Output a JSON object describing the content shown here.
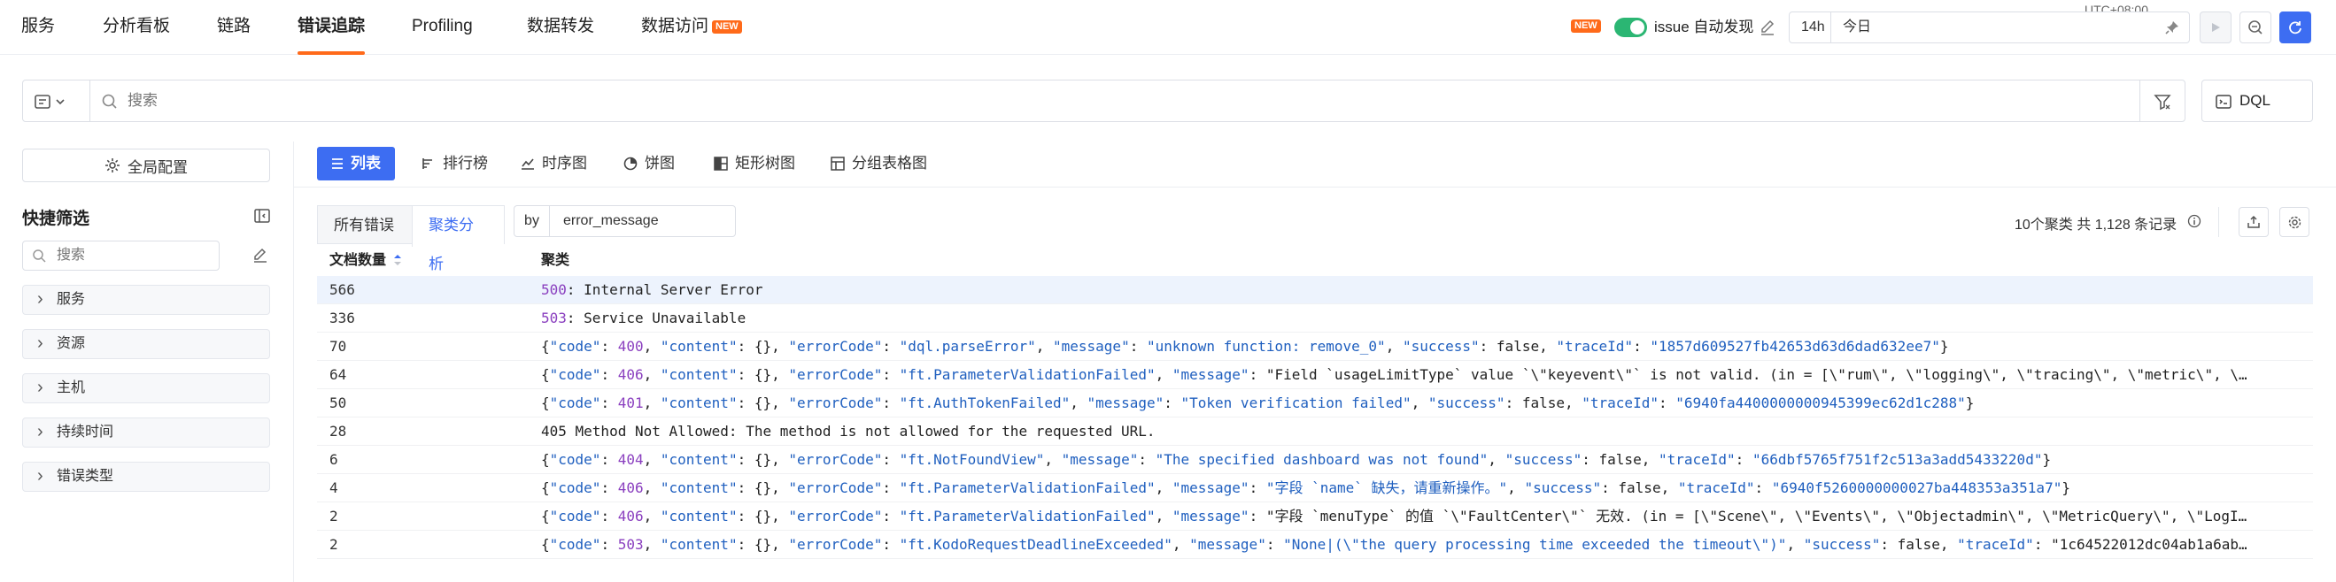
{
  "nav": {
    "items": [
      "服务",
      "分析看板",
      "链路",
      "错误追踪",
      "Profiling",
      "数据转发",
      "数据访问"
    ],
    "active": "错误追踪",
    "new_badge": "NEW"
  },
  "header": {
    "timezone": "UTC+08:00",
    "issue_badge": "NEW",
    "issue_label": "issue 自动发现",
    "time_range_short": "14h",
    "time_range_value": "今日"
  },
  "search": {
    "placeholder": "搜索",
    "dql_label": "DQL"
  },
  "sidebar": {
    "global_config": "全局配置",
    "quick_filter_title": "快捷筛选",
    "filter_search_placeholder": "搜索",
    "facets": [
      "服务",
      "资源",
      "主机",
      "持续时间",
      "错误类型"
    ]
  },
  "views": {
    "tabs": [
      "列表",
      "排行榜",
      "时序图",
      "饼图",
      "矩形树图",
      "分组表格图"
    ],
    "active": "列表"
  },
  "analysis": {
    "modes": [
      "所有错误",
      "聚类分析"
    ],
    "active_mode": "聚类分析",
    "by_label": "by",
    "by_field": "error_message",
    "summary": "10个聚类 共 1,128 条记录"
  },
  "table": {
    "columns": [
      "文档数量",
      "聚类"
    ],
    "rows": [
      {
        "count": "566",
        "message": "500: Internal Server Error"
      },
      {
        "count": "336",
        "message": "503: Service Unavailable"
      },
      {
        "count": "70",
        "message": "{\"code\": 400, \"content\": {}, \"errorCode\": \"dql.parseError\", \"message\": \"unknown function: remove_0\", \"success\": false, \"traceId\": \"1857d609527fb42653d63d6dad632ee7\"}"
      },
      {
        "count": "64",
        "message": "{\"code\": 406, \"content\": {}, \"errorCode\": \"ft.ParameterValidationFailed\", \"message\": \"Field `usageLimitType` value `\\\"keyevent\\\"` is not valid. (in = [\\\"rum\\\", \\\"logging\\\", \\\"tracing\\\", \\\"metric\\\", \\…"
      },
      {
        "count": "50",
        "message": "{\"code\": 401, \"content\": {}, \"errorCode\": \"ft.AuthTokenFailed\", \"message\": \"Token verification failed\", \"success\": false, \"traceId\": \"6940fa4400000000945399ec62d1c288\"}"
      },
      {
        "count": "28",
        "message": "405 Method Not Allowed: The method is not allowed for the requested URL."
      },
      {
        "count": "6",
        "message": "{\"code\": 404, \"content\": {}, \"errorCode\": \"ft.NotFoundView\", \"message\": \"The specified dashboard was not found\", \"success\": false, \"traceId\": \"66dbf5765f751f2c513a3add5433220d\"}"
      },
      {
        "count": "4",
        "message": "{\"code\": 406, \"content\": {}, \"errorCode\": \"ft.ParameterValidationFailed\", \"message\": \"字段 `name` 缺失，请重新操作。\", \"success\": false, \"traceId\": \"6940f5260000000027ba448353a351a7\"}"
      },
      {
        "count": "2",
        "message": "{\"code\": 406, \"content\": {}, \"errorCode\": \"ft.ParameterValidationFailed\", \"message\": \"字段 `menuType` 的值 `\\\"FaultCenter\\\"` 无效. (in = [\\\"Scene\\\", \\\"Events\\\", \\\"Objectadmin\\\", \\\"MetricQuery\\\", \\\"LogI…"
      },
      {
        "count": "2",
        "message": "{\"code\": 503, \"content\": {}, \"errorCode\": \"ft.KodoRequestDeadlineExceeded\", \"message\": \"None|(\\\"the query processing time exceeded the timeout\\\")\", \"success\": false, \"traceId\": \"1c64522012dc04ab1a6ab…"
      }
    ]
  },
  "colors": {
    "accent": "#3d6df2",
    "nav_active_underline": "#ff6a1a",
    "toggle_on": "#2bb673",
    "json_key": "#1f5fbf",
    "json_number": "#8a3fbf"
  }
}
